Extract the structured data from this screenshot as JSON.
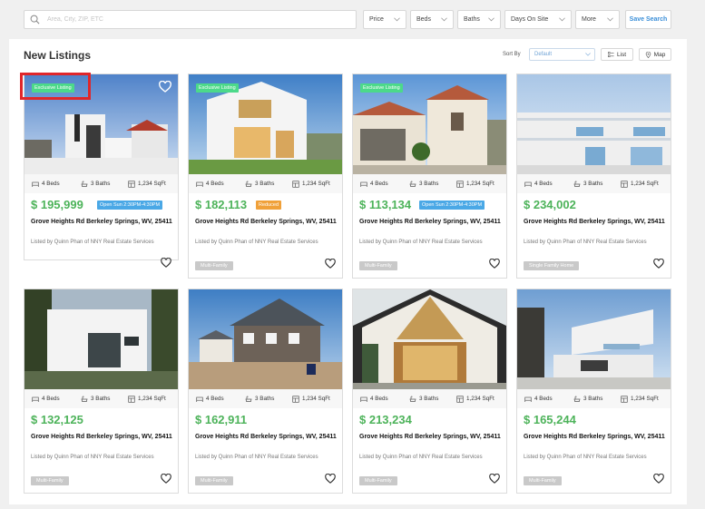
{
  "search": {
    "placeholder": "Area, City, ZIP, ETC"
  },
  "filters": {
    "price": "Price",
    "beds": "Beds",
    "baths": "Baths",
    "days": "Days On Site",
    "more": "More",
    "save": "Save Search"
  },
  "section_title": "New Listings",
  "sort": {
    "label": "Sort By",
    "value": "Default"
  },
  "view": {
    "list": "List",
    "map": "Map"
  },
  "colors": {
    "price": "#4db35a",
    "badge": "#4cd98a",
    "open": "#4aa8e6",
    "reduced": "#f0a13a",
    "highlight": "#e0262a"
  },
  "listings": [
    {
      "badge": "Exclusive Listing",
      "beds": "4 Beds",
      "baths": "3 Baths",
      "sqft": "1,234 SqFt",
      "price": "$ 195,999",
      "tag": "Open Sun 2:30PM-4:30PM",
      "address": "Grove Heights Rd Berkeley Springs, WV, 25411",
      "listed": "Listed by Quinn Phan of NNY Real Estate Services",
      "type": ""
    },
    {
      "badge": "Exclusive Listing",
      "beds": "4 Beds",
      "baths": "3 Baths",
      "sqft": "1,234 SqFt",
      "price": "$ 182,113",
      "tag": "Reduced",
      "address": "Grove Heights Rd Berkeley Springs, WV, 25411",
      "listed": "Listed by Quinn Phan of NNY Real Estate Services",
      "type": "Multi-Family"
    },
    {
      "badge": "Exclusive Listing",
      "beds": "4 Beds",
      "baths": "3 Baths",
      "sqft": "1,234 SqFt",
      "price": "$ 113,134",
      "tag": "Open Sun 2:30PM-4:30PM",
      "address": "Grove Heights Rd Berkeley Springs, WV, 25411",
      "listed": "Listed by Quinn Phan of NNY Real Estate Services",
      "type": "Multi-Family"
    },
    {
      "badge": "",
      "beds": "4 Beds",
      "baths": "3 Baths",
      "sqft": "1,234 SqFt",
      "price": "$ 234,002",
      "tag": "",
      "address": "Grove Heights Rd Berkeley Springs, WV, 25411",
      "listed": "Listed by Quinn Phan of NNY Real Estate Services",
      "type": "Single Family Home"
    },
    {
      "badge": "",
      "beds": "4 Beds",
      "baths": "3 Baths",
      "sqft": "1,234 SqFt",
      "price": "$ 132,125",
      "tag": "",
      "address": "Grove Heights Rd Berkeley Springs, WV, 25411",
      "listed": "Listed by Quinn Phan of NNY Real Estate Services",
      "type": "Multi-Family"
    },
    {
      "badge": "",
      "beds": "4 Beds",
      "baths": "3 Baths",
      "sqft": "1,234 SqFt",
      "price": "$ 162,911",
      "tag": "",
      "address": "Grove Heights Rd Berkeley Springs, WV, 25411",
      "listed": "Listed by Quinn Phan of NNY Real Estate Services",
      "type": "Multi-Family"
    },
    {
      "badge": "",
      "beds": "4 Beds",
      "baths": "3 Baths",
      "sqft": "1,234 SqFt",
      "price": "$ 213,234",
      "tag": "",
      "address": "Grove Heights Rd Berkeley Springs, WV, 25411",
      "listed": "Listed by Quinn Phan of NNY Real Estate Services",
      "type": "Multi-Family"
    },
    {
      "badge": "",
      "beds": "4 Beds",
      "baths": "3 Baths",
      "sqft": "1,234 SqFt",
      "price": "$ 165,244",
      "tag": "",
      "address": "Grove Heights Rd Berkeley Springs, WV, 25411",
      "listed": "Listed by Quinn Phan of NNY Real Estate Services",
      "type": "Multi-Family"
    }
  ]
}
